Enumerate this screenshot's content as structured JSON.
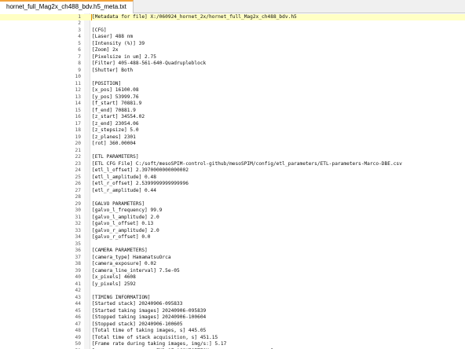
{
  "tab": {
    "title": "hornet_full_Mag2x_ch488_bdv.h5_meta.txt"
  },
  "editor": {
    "current_line": 1,
    "lines": [
      {
        "num": "1",
        "text": "[Metadata for file] X:/060924_hornet_2x/hornet_full_Mag2x_ch488_bdv.h5"
      },
      {
        "num": "2",
        "text": ""
      },
      {
        "num": "3",
        "text": "[CFG]"
      },
      {
        "num": "4",
        "text": "[Laser] 488 nm"
      },
      {
        "num": "5",
        "text": "[Intensity (%)] 39"
      },
      {
        "num": "6",
        "text": "[Zoom] 2x"
      },
      {
        "num": "7",
        "text": "[Pixelsize in um] 2.75"
      },
      {
        "num": "8",
        "text": "[Filter] 405-488-561-640-Quadrupleblock"
      },
      {
        "num": "9",
        "text": "[Shutter] Both"
      },
      {
        "num": "10",
        "text": ""
      },
      {
        "num": "11",
        "text": "[POSITION]"
      },
      {
        "num": "12",
        "text": "[x_pos] 16100.08"
      },
      {
        "num": "13",
        "text": "[y_pos] 53999.76"
      },
      {
        "num": "14",
        "text": "[f_start] 70881.9"
      },
      {
        "num": "15",
        "text": "[f_end] 70881.9"
      },
      {
        "num": "16",
        "text": "[z_start] 34554.02"
      },
      {
        "num": "17",
        "text": "[z_end] 23054.06"
      },
      {
        "num": "18",
        "text": "[z_stepsize] 5.0"
      },
      {
        "num": "19",
        "text": "[z_planes] 2301"
      },
      {
        "num": "20",
        "text": "[rot] 360.00004"
      },
      {
        "num": "21",
        "text": ""
      },
      {
        "num": "22",
        "text": "[ETL PARAMETERS]"
      },
      {
        "num": "23",
        "text": "[ETL CFG File] C:/soft/mesoSPIM-control-github/mesoSPIM/config/etl_parameters/ETL-parameters-Marco-DBE.csv"
      },
      {
        "num": "24",
        "text": "[etl_l_offset] 2.3970000000000002"
      },
      {
        "num": "25",
        "text": "[etl_l_amplitude] 0.48"
      },
      {
        "num": "26",
        "text": "[etl_r_offset] 2.5399999999999996"
      },
      {
        "num": "27",
        "text": "[etl_r_amplitude] 0.44"
      },
      {
        "num": "28",
        "text": ""
      },
      {
        "num": "29",
        "text": "[GALVO PARAMETERS]"
      },
      {
        "num": "30",
        "text": "[galvo_l_frequency] 99.9"
      },
      {
        "num": "31",
        "text": "[galvo_l_amplitude] 2.0"
      },
      {
        "num": "32",
        "text": "[galvo_l_offset] 0.13"
      },
      {
        "num": "33",
        "text": "[galvo_r_amplitude] 2.0"
      },
      {
        "num": "34",
        "text": "[galvo_r_offset] 0.0"
      },
      {
        "num": "35",
        "text": ""
      },
      {
        "num": "36",
        "text": "[CAMERA PARAMETERS]"
      },
      {
        "num": "37",
        "text": "[camera_type] HamamatsuOrca"
      },
      {
        "num": "38",
        "text": "[camera_exposure] 0.02"
      },
      {
        "num": "39",
        "text": "[camera_line_interval] 7.5e-05"
      },
      {
        "num": "40",
        "text": "[x_pixels] 4608"
      },
      {
        "num": "41",
        "text": "[y_pixels] 2592"
      },
      {
        "num": "42",
        "text": ""
      },
      {
        "num": "43",
        "text": "[TIMING INFORMATION]"
      },
      {
        "num": "44",
        "text": "[Started stack] 20240906-095833"
      },
      {
        "num": "45",
        "text": "[Started taking images] 20240906-095839"
      },
      {
        "num": "46",
        "text": "[Stopped taking images] 20240906-100604"
      },
      {
        "num": "47",
        "text": "[Stopped stack] 20240906-100605"
      },
      {
        "num": "48",
        "text": "[Total time of taking images, s] 445.05"
      },
      {
        "num": "49",
        "text": "[Total time of stack acquisition, s] 451.15"
      },
      {
        "num": "50",
        "text": "[Frame rate during taking images, img/s:] 5.17"
      },
      {
        "num": "51",
        "text": "[==================== END OF ACQUISITION ====================]"
      }
    ]
  }
}
